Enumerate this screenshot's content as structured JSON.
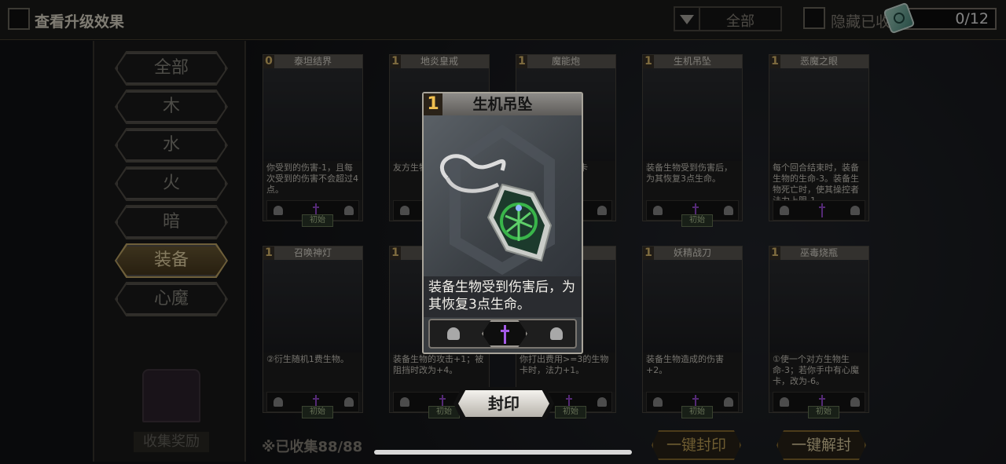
{
  "topbar": {
    "upgrade_label": "查看升级效果",
    "filter_value": "全部",
    "hide_label": "隐藏已收",
    "counter": "0/12"
  },
  "categories": [
    "全部",
    "木",
    "水",
    "火",
    "暗",
    "装备",
    "心魔"
  ],
  "active_category": "装备",
  "reward_label": "收集奖励",
  "collected_label": "※已收集88/88",
  "cards_row1": [
    {
      "cost": "0",
      "name": "泰坦结界",
      "desc": "你受到的伤害-1，且每次受到的伤害不会超过4点。",
      "tag": "初始"
    },
    {
      "cost": "1",
      "name": "地炎皇戒",
      "desc": "友方生物...生命-2",
      "tag": ""
    },
    {
      "cost": "1",
      "name": "魔能炮",
      "desc": "...，使对...魔法卡",
      "tag": ""
    },
    {
      "cost": "1",
      "name": "生机吊坠",
      "desc": "装备生物受到伤害后，为其恢复3点生命。",
      "tag": "初始"
    },
    {
      "cost": "1",
      "name": "恶魔之眼",
      "desc": "每个回合结束时，装备生物的生命-3。装备生物死亡时，使其操控者法力上限-1。",
      "tag": ""
    }
  ],
  "cards_row2": [
    {
      "cost": "1",
      "name": "召唤神灯",
      "desc": "②衍生随机1费生物。",
      "tag": "初始"
    },
    {
      "cost": "1",
      "name": "",
      "desc": "装备生物的攻击+1；被阻挡时改为+4。",
      "tag": "初始"
    },
    {
      "cost": "1",
      "name": "球",
      "desc": "你打出费用>=3的生物卡时，法力+1。",
      "tag": "初始"
    },
    {
      "cost": "1",
      "name": "妖精战刀",
      "desc": "装备生物造成的伤害+2。",
      "tag": "初始"
    },
    {
      "cost": "1",
      "name": "巫毒烧瓶",
      "desc": "①使一个对方生物生命-3；若你手中有心魔卡，改为-6。",
      "tag": "初始"
    }
  ],
  "popup": {
    "cost": "1",
    "title": "生机吊坠",
    "desc": "装备生物受到伤害后，为其恢复3点生命。"
  },
  "seal_label": "封印",
  "one_key_seal": "一键封印",
  "one_key_unseal": "一键解封",
  "colors": {
    "accent_gold": "#c8a85a",
    "dagger_purple": "#9a4cd6",
    "pendant_green": "#39b54a"
  },
  "icons": [
    "helmet-icon",
    "dagger-icon",
    "chest-icon",
    "gem-icon"
  ]
}
